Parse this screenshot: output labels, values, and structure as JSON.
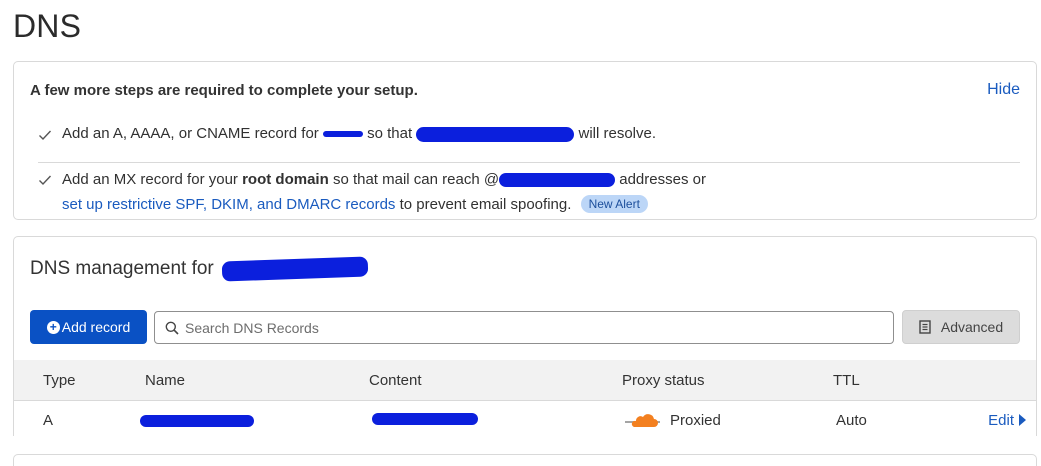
{
  "page": {
    "title": "DNS"
  },
  "setup": {
    "heading": "A few more steps are required to complete your setup.",
    "hide_label": "Hide",
    "step1": {
      "part1": "Add an A, AAAA, or CNAME record for",
      "part2": "so that",
      "part3": "will resolve."
    },
    "step2": {
      "part1": "Add an MX record for your",
      "bold": "root domain",
      "part2": "so that mail can reach @",
      "part3": "addresses or",
      "link": "set up restrictive SPF, DKIM, and DMARC records",
      "part4": "to prevent email spoofing.",
      "badge": "New Alert"
    }
  },
  "dns_management": {
    "heading": "DNS management for",
    "add_record_label": "Add record",
    "search_placeholder": "Search DNS Records",
    "advanced_label": "Advanced",
    "columns": [
      "Type",
      "Name",
      "Content",
      "Proxy status",
      "TTL"
    ],
    "rows": [
      {
        "type": "A",
        "proxy_status": "Proxied",
        "ttl": "Auto",
        "action": "Edit"
      }
    ]
  },
  "colors": {
    "accent": "#0a51c4",
    "link": "#1a5bbf",
    "redaction": "#0b1fdd",
    "proxy_cloud": "#f38020"
  },
  "icons": [
    "check-icon",
    "plus-circle-icon",
    "search-icon",
    "document-icon",
    "cloud-icon",
    "caret-right-icon"
  ]
}
